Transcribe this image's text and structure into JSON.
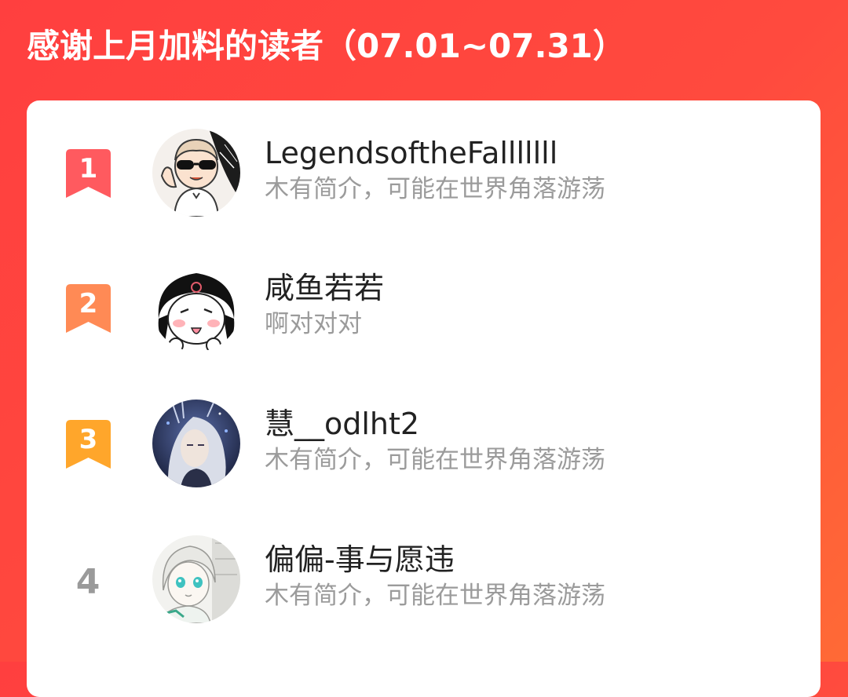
{
  "header": {
    "title": "感谢上月加料的读者（07.01~07.31）"
  },
  "colors": {
    "background_start": "#ff3f3f",
    "background_end": "#ff6a36",
    "rank1": "#ff5a5f",
    "rank2": "#ff8a55",
    "rank3": "#ffa62b",
    "rank_plain": "#9a9a9a",
    "name_text": "#222222",
    "bio_text": "#9b9b9b"
  },
  "readers": [
    {
      "rank": "1",
      "rank_style": "ribbon-red",
      "name": "LegendsoftheFalllllll",
      "bio": "木有简介，可能在世界角落游荡",
      "avatar_icon": "sunglasses-cartoon-avatar"
    },
    {
      "rank": "2",
      "rank_style": "ribbon-orange",
      "name": "咸鱼若若",
      "bio": "啊对对对",
      "avatar_icon": "cartoon-girl-avatar"
    },
    {
      "rank": "3",
      "rank_style": "ribbon-gold",
      "name": "慧__odlht2",
      "bio": "木有简介，可能在世界角落游荡",
      "avatar_icon": "anime-character-avatar"
    },
    {
      "rank": "4",
      "rank_style": "plain-number",
      "name": "偏偏-事与愿违",
      "bio": "木有简介，可能在世界角落游荡",
      "avatar_icon": "anime-girl-sketch-avatar"
    }
  ]
}
